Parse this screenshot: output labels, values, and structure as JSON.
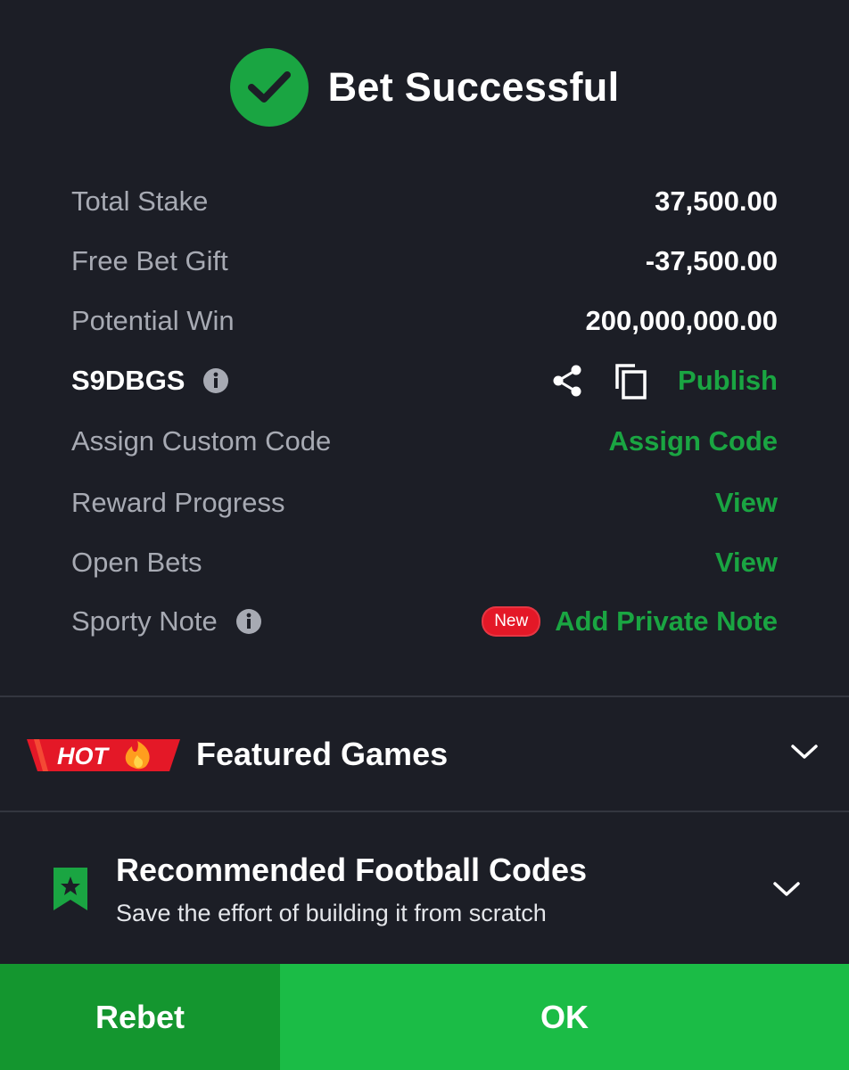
{
  "header": {
    "title": "Bet Successful",
    "icon": "check-circle-icon",
    "accent": "#1aa542"
  },
  "summary": {
    "total_stake": {
      "label": "Total Stake",
      "value": "37,500.00"
    },
    "free_bet_gift": {
      "label": "Free Bet Gift",
      "value": "-37,500.00"
    },
    "potential_win": {
      "label": "Potential Win",
      "value": "200,000,000.00"
    }
  },
  "booking": {
    "code": "S9DBGS",
    "publish_label": "Publish"
  },
  "actions": {
    "assign_custom_code": {
      "label": "Assign Custom Code",
      "action": "Assign Code"
    },
    "reward_progress": {
      "label": "Reward Progress",
      "action": "View"
    },
    "open_bets": {
      "label": "Open Bets",
      "action": "View"
    },
    "sporty_note": {
      "label": "Sporty Note",
      "badge": "New",
      "action": "Add Private Note"
    }
  },
  "featured": {
    "badge": "HOT",
    "title": "Featured Games"
  },
  "recommended": {
    "title": "Recommended Football Codes",
    "subtitle": "Save the effort of building it from scratch"
  },
  "footer": {
    "rebet_label": "Rebet",
    "ok_label": "OK"
  },
  "colors": {
    "background": "#1c1e26",
    "green": "#1aa542",
    "ok_green": "#1bbc46",
    "rebet_green": "#14962f",
    "badge_red": "#e41827"
  }
}
